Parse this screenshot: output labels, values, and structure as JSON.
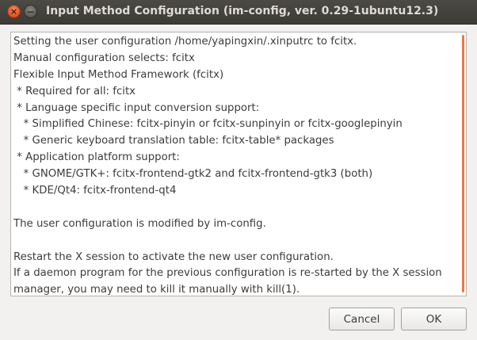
{
  "window": {
    "title": "Input Method Configuration (im-config, ver. 0.29-1ubuntu12.3)",
    "close_icon": "×",
    "minimize_icon": "−"
  },
  "message": {
    "lines": [
      "Setting the user configuration /home/yapingxin/.xinputrc to fcitx.",
      "Manual configuration selects: fcitx",
      "Flexible Input Method Framework (fcitx)",
      " * Required for all: fcitx",
      " * Language specific input conversion support:",
      "   * Simplified Chinese: fcitx-pinyin or fcitx-sunpinyin or fcitx-googlepinyin",
      "   * Generic keyboard translation table: fcitx-table* packages",
      " * Application platform support:",
      "   * GNOME/GTK+: fcitx-frontend-gtk2 and fcitx-frontend-gtk3 (both)",
      "   * KDE/Qt4: fcitx-frontend-qt4",
      "",
      "The user configuration is modified by im-config.",
      "",
      "Restart the X session to activate the new user configuration.",
      "If a daemon program for the previous configuration is re-started by the X session",
      "manager, you may need to kill it manually with kill(1)."
    ]
  },
  "buttons": {
    "cancel_label": "Cancel",
    "ok_label": "OK"
  },
  "colors": {
    "accent": "#f07746",
    "titlebar": "#3c3b37"
  }
}
